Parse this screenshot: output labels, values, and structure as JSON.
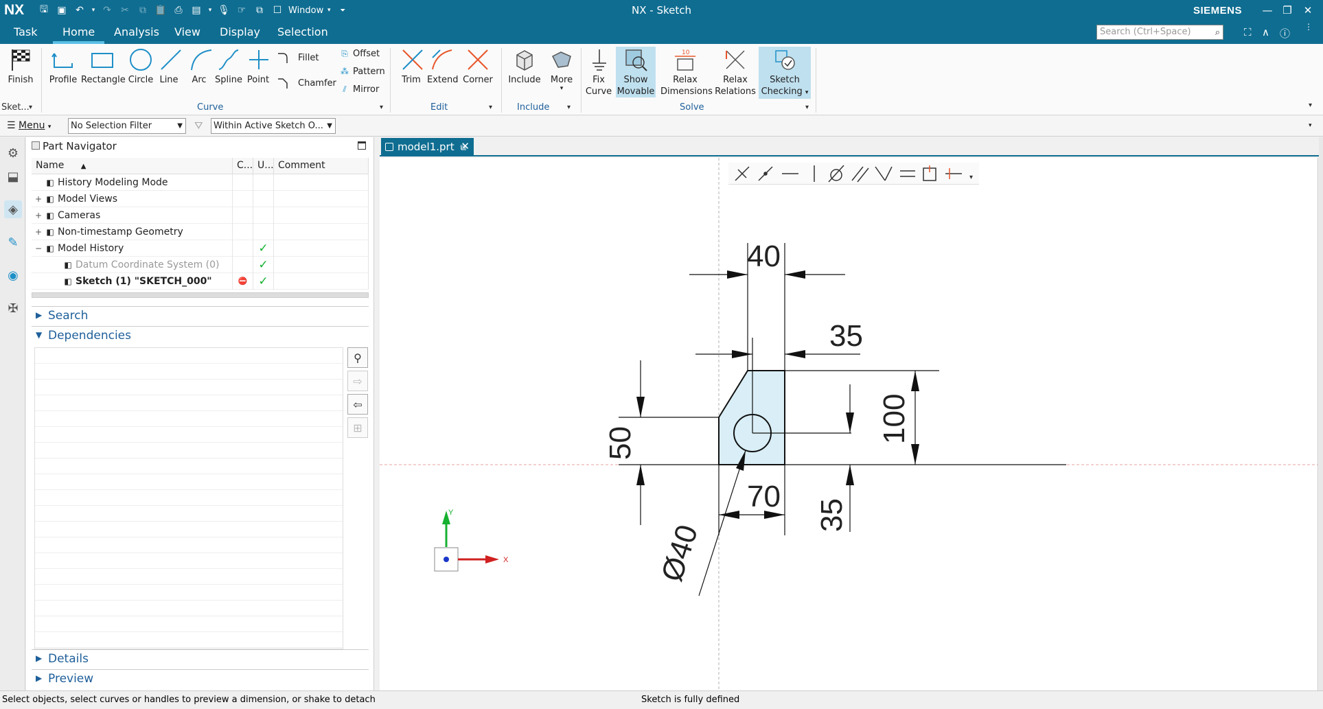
{
  "app": {
    "logo": "NX",
    "window_title": "NX - Sketch",
    "brand": "SIEMENS",
    "window_menu": "Window"
  },
  "tabs": [
    "Task",
    "Home",
    "Analysis",
    "View",
    "Display",
    "Selection"
  ],
  "active_tab": "Home",
  "search": {
    "placeholder": "Search (Ctrl+Space)"
  },
  "ribbon": {
    "sketch_group": {
      "finish": "Finish",
      "label": "Sket..."
    },
    "curve_group": {
      "label": "Curve",
      "tools": [
        "Profile",
        "Rectangle",
        "Circle",
        "Line",
        "Arc",
        "Spline",
        "Point"
      ],
      "fillet": "Fillet",
      "chamfer": "Chamfer",
      "offset": "Offset",
      "pattern": "Pattern",
      "mirror": "Mirror"
    },
    "edit_group": {
      "label": "Edit",
      "tools": [
        "Trim",
        "Extend",
        "Corner"
      ]
    },
    "include_group": {
      "label": "Include",
      "include": "Include",
      "more": "More"
    },
    "solve_group": {
      "label": "Solve",
      "fix": [
        "Fix",
        "Curve"
      ],
      "show": [
        "Show",
        "Movable"
      ],
      "relax_dim": [
        "Relax",
        "Dimensions"
      ],
      "relax_rel": [
        "Relax",
        "Relations"
      ],
      "check": [
        "Sketch",
        "Checking"
      ]
    }
  },
  "selection_bar": {
    "menu": "Menu",
    "filter": "No Selection Filter",
    "scope": "Within Active Sketch O..."
  },
  "part_navigator": {
    "title": "Part Navigator",
    "columns": [
      "Name",
      "C...",
      "U...",
      "Comment"
    ],
    "rows": [
      {
        "name": "History Modeling Mode",
        "expander": "",
        "icon": "clock-icon",
        "u": "",
        "c": ""
      },
      {
        "name": "Model Views",
        "expander": "+",
        "icon": "views-icon",
        "u": "",
        "c": ""
      },
      {
        "name": "Cameras",
        "expander": "+",
        "icon": "camera-icon",
        "u": "",
        "c": ""
      },
      {
        "name": "Non-timestamp Geometry",
        "expander": "+",
        "icon": "folder-icon",
        "u": "",
        "c": ""
      },
      {
        "name": "Model History",
        "expander": "−",
        "icon": "history-icon",
        "u": "✓",
        "c": ""
      },
      {
        "name": "Datum Coordinate System (0)",
        "expander": "",
        "icon": "datum-csys-icon",
        "u": "✓",
        "c": "",
        "dim": true
      },
      {
        "name": "Sketch (1) \"SKETCH_000\"",
        "expander": "",
        "icon": "sketch-icon",
        "u": "✓",
        "c": "⛔",
        "bold": true
      }
    ],
    "sections": {
      "search": "Search",
      "dependencies": "Dependencies",
      "details": "Details",
      "preview": "Preview"
    }
  },
  "document_tab": {
    "label": "model1.prt"
  },
  "sketch": {
    "dimensions": [
      "40",
      "35",
      "50",
      "100",
      "70",
      "35",
      "Ø40"
    ],
    "axis_x": "X",
    "axis_y": "Y"
  },
  "status": {
    "left": "Select objects, select curves or handles to preview a dimension, or shake to detach",
    "right": "Sketch is fully defined"
  },
  "colors": {
    "accent": "#0f6d91",
    "check": "#16b130",
    "sketch_fill": "#d9eef6"
  }
}
